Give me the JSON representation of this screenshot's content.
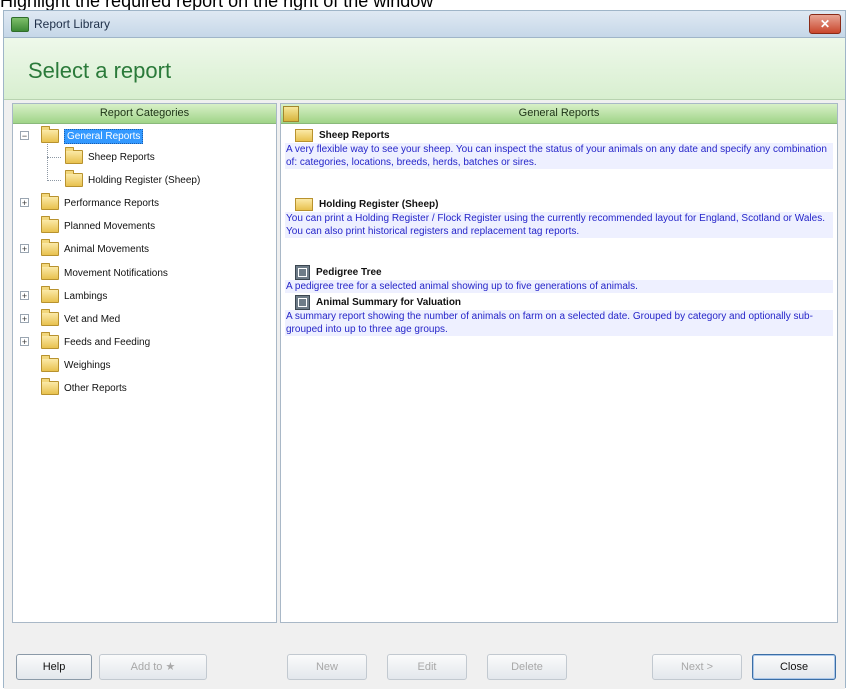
{
  "caption": "Highlight the required report on the right of the window",
  "window": {
    "title": "Report Library",
    "close_glyph": "✕"
  },
  "header": {
    "title": "Select a report"
  },
  "left_pane": {
    "header": "Report Categories",
    "tree": [
      {
        "label": "General Reports",
        "selected": true,
        "expander": "−"
      },
      {
        "label": "Sheep Reports"
      },
      {
        "label": "Holding Register (Sheep)"
      },
      {
        "label": "Performance Reports",
        "expander": "+"
      },
      {
        "label": "Planned Movements"
      },
      {
        "label": "Animal Movements",
        "expander": "+"
      },
      {
        "label": "Movement Notifications"
      },
      {
        "label": "Lambings",
        "expander": "+"
      },
      {
        "label": "Vet and Med",
        "expander": "+"
      },
      {
        "label": "Feeds and Feeding",
        "expander": "+"
      },
      {
        "label": "Weighings"
      },
      {
        "label": "Other Reports"
      }
    ]
  },
  "right_pane": {
    "header": "General Reports",
    "reports": [
      {
        "title": "Sheep Reports",
        "icon": "folder-icon",
        "description": "A very flexible way to see your sheep. You can inspect the status of your animals on any date and specify any combination of: categories, locations, breeds, herds, batches or sires."
      },
      {
        "title": "Holding Register (Sheep)",
        "icon": "folder-icon",
        "description": "You can print a Holding Register / Flock Register using the currently recommended layout for England, Scotland or Wales. You can also print historical registers and replacement tag reports."
      },
      {
        "title": "Pedigree Tree",
        "icon": "report-icon",
        "description": "A pedigree tree for a selected animal showing up to five generations of animals."
      },
      {
        "title": "Animal Summary for Valuation",
        "icon": "report-icon",
        "description": "A summary report showing the number of animals on farm on a selected date. Grouped by category and optionally sub-grouped into up to three age groups."
      }
    ]
  },
  "buttons": {
    "help": "Help",
    "add_to": "Add to ★",
    "new": "New",
    "edit": "Edit",
    "delete": "Delete",
    "next": "Next >",
    "close": "Close"
  }
}
